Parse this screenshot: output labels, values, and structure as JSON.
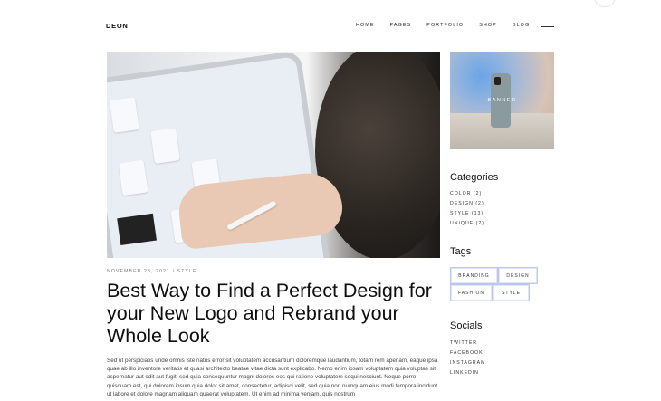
{
  "header": {
    "logo": "DEON",
    "nav": [
      "HOME",
      "PAGES",
      "PORTFOLIO",
      "SHOP",
      "BLOG"
    ]
  },
  "post": {
    "meta": "NOVEMBER 23, 2021 / STYLE",
    "title": "Best Way to Find a Perfect Design for your New Logo and Rebrand your Whole Look",
    "excerpt": "Sed ut perspiciatis unde omnis iste natus error sit voluptatem accusantium doloremque laudantium, totam rem aperiam, eaque ipsa quae ab illo inventore veritatis et quasi architecto beatae vitae dicta sunt explicabo. Nemo enim ipsam voluptatem quia voluptas sit aspernatur aut odit aut fugit, sed quia consequuntur magni dolores eos qui ratione voluptatem sequi nesciunt. Neque porro quisquam est, qui dolorem ipsum quia dolor sit amet, consectetur, adipisci velit, sed quia non numquam eius modi tempora incidunt ut labore et dolore magnam aliquam quaerat voluptatem. Ut enim ad minima veniam, quis nostrum"
  },
  "sidebar": {
    "banner_label": "BANNER",
    "categories_title": "Categories",
    "categories": [
      "COLOR (2)",
      "DESIGN (2)",
      "STYLE (13)",
      "UNIQUE (2)"
    ],
    "tags_title": "Tags",
    "tags": [
      "BRANDING",
      "DESIGN",
      "FASHION",
      "STYLE"
    ],
    "socials_title": "Socials",
    "socials": [
      "TWITTER",
      "FACEBOOK",
      "INSTAGRAM",
      "LINKEDIN"
    ]
  },
  "colors": {
    "tag_border": "#bcc7f0",
    "text": "#111111"
  }
}
